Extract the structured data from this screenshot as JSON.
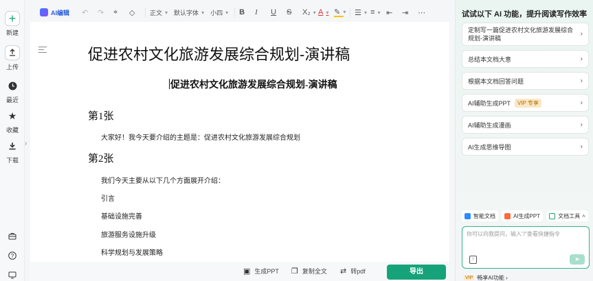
{
  "rail": {
    "new_label": "新建",
    "upload_label": "上传",
    "recent_label": "最近",
    "favorites_label": "收藏",
    "download_label": "下载"
  },
  "toolbar": {
    "ai_edit_label": "AI编辑",
    "paragraph_style": "正文",
    "font_family": "默认字体",
    "font_size": "小四"
  },
  "document": {
    "title": "促进农村文化旅游发展综合规划-演讲稿",
    "subtitle": "促进农村文化旅游发展综合规划-演讲稿",
    "sections": [
      {
        "heading": "第1张",
        "paragraphs": [
          "大家好！我今天要介绍的主题是：促进农村文化旅游发展综合规划"
        ]
      },
      {
        "heading": "第2张",
        "paragraphs": [
          "我们今天主要从以下几个方面展开介绍：",
          "引言",
          "基础设施完善",
          "旅游服务设施升级",
          "科学规划与发展策略"
        ]
      }
    ]
  },
  "bottom_bar": {
    "gen_ppt": "生成PPT",
    "copy_all": "复制全文",
    "to_pdf": "转pdf",
    "export": "导出"
  },
  "ai_panel": {
    "title": "试试以下 AI 功能，提升阅读写作效率",
    "suggestions": [
      {
        "label": "定制写一篇促进农村文化旅游发展综合规划-演讲稿"
      },
      {
        "label": "总结本文档大意"
      },
      {
        "label": "根据本文档回答问题"
      },
      {
        "label": "AI辅助生成PPT",
        "badge": "VIP 专享"
      },
      {
        "label": "AI辅助生成漫画"
      },
      {
        "label": "AI生成思维导图"
      }
    ],
    "tools": [
      "智能文档",
      "AI生成PPT",
      "文档工具"
    ],
    "input_placeholder": "你可以向我提问，输入\"/\"查看快捷指令",
    "footer_vip_tag": "VIP",
    "footer_text": "畅享AI功能 ›"
  },
  "colors": {
    "accent_green": "#17a37a",
    "ai_blue": "#2b5fd9",
    "vip_bg": "#fbe7c4"
  }
}
